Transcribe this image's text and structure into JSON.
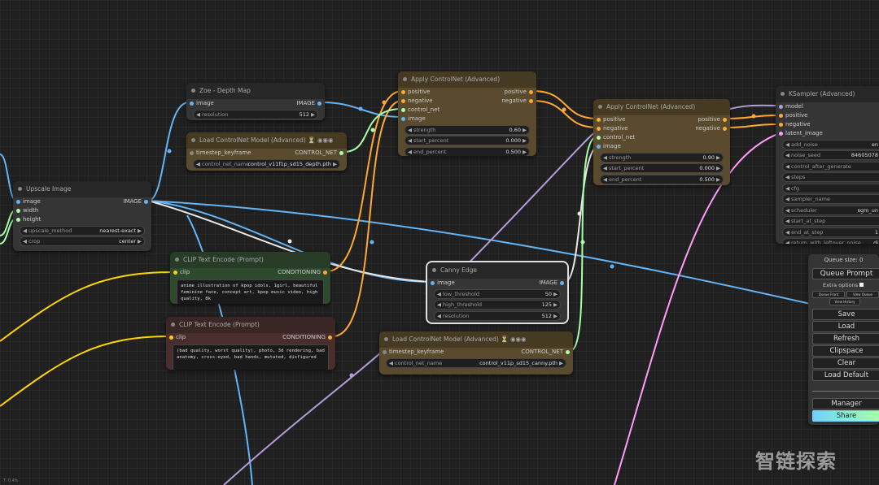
{
  "colors": {
    "image": "#64b5f6",
    "conditioning": "#ffa931",
    "control_net": "#a8ffa8",
    "model": "#b39ddb",
    "latent": "#ff9cf9",
    "int": "#a8ffa8",
    "clip": "#ffd500"
  },
  "nodes": {
    "zoe": {
      "title": "Zoe - Depth Map",
      "input": "image",
      "output": "IMAGE",
      "widgets": [
        {
          "name": "resolution",
          "value": "512"
        }
      ]
    },
    "load_cn_depth": {
      "title": "Load ControlNet Model (Advanced) ⏳ ◉◉◉",
      "input": "timestep_keyframe",
      "output": "CONTROL_NET",
      "widgets": [
        {
          "name": "control_net_name",
          "value": "control_v11f1p_sd15_depth.pth"
        }
      ]
    },
    "upscale": {
      "title": "Upscale Image",
      "inputs": [
        "image",
        "width",
        "height"
      ],
      "output": "IMAGE",
      "widgets": [
        {
          "name": "upscale_method",
          "value": "nearest-exact"
        },
        {
          "name": "crop",
          "value": "center"
        }
      ]
    },
    "apply1": {
      "title": "Apply ControlNet (Advanced)",
      "inputs": [
        "positive",
        "negative",
        "control_net",
        "image"
      ],
      "outputs": [
        "positive",
        "negative"
      ],
      "widgets": [
        {
          "name": "strength",
          "value": "0.60"
        },
        {
          "name": "start_percent",
          "value": "0.000"
        },
        {
          "name": "end_percent",
          "value": "0.500"
        }
      ]
    },
    "apply2": {
      "title": "Apply ControlNet (Advanced)",
      "inputs": [
        "positive",
        "negative",
        "control_net",
        "image"
      ],
      "outputs": [
        "positive",
        "negative"
      ],
      "widgets": [
        {
          "name": "strength",
          "value": "0.90"
        },
        {
          "name": "start_percent",
          "value": "0.000"
        },
        {
          "name": "end_percent",
          "value": "0.500"
        }
      ]
    },
    "ksampler": {
      "title": "KSampler (Advanced)",
      "inputs": [
        "model",
        "positive",
        "negative",
        "latent_image"
      ],
      "widgets": [
        {
          "name": "add_noise",
          "value": "en"
        },
        {
          "name": "noise_seed",
          "value": "84605078"
        },
        {
          "name": "control_after_generate",
          "value": ""
        },
        {
          "name": "steps",
          "value": ""
        },
        {
          "name": "cfg",
          "value": ""
        },
        {
          "name": "sampler_name",
          "value": ""
        },
        {
          "name": "scheduler",
          "value": "sgm_un"
        },
        {
          "name": "start_at_step",
          "value": ""
        },
        {
          "name": "end_at_step",
          "value": "1"
        },
        {
          "name": "return_with_leftover_noise",
          "value": "di"
        }
      ]
    },
    "clip_pos": {
      "title": "CLIP Text Encode (Prompt)",
      "input": "clip",
      "output": "CONDITIONING",
      "text": "anime illustration of kpop idols, 1girl, beautiful feminine face,  concept art, kpop music video, high quality, 8k"
    },
    "clip_neg": {
      "title": "CLIP Text Encode (Prompt)",
      "input": "clip",
      "output": "CONDITIONING",
      "text": "(bad quality, worst quality), photo, 3d rendering, bad anatomy, cross-eyed, bad hands, mutated, disfigured"
    },
    "canny": {
      "title": "Canny Edge",
      "input": "image",
      "output": "IMAGE",
      "widgets": [
        {
          "name": "low_threshold",
          "value": "50"
        },
        {
          "name": "high_threshold",
          "value": "125"
        },
        {
          "name": "resolution",
          "value": "512"
        }
      ]
    },
    "load_cn_canny": {
      "title": "Load ControlNet Model (Advanced) ⏳ ◉◉◉",
      "input": "timestep_keyframe",
      "output": "CONTROL_NET",
      "widgets": [
        {
          "name": "control_net_name",
          "value": "control_v11p_sd15_canny.pth"
        }
      ]
    }
  },
  "menu": {
    "queue_size": "Queue size: 0",
    "queue_prompt": "Queue Prompt",
    "extra_options": "Extra options",
    "queue_front": "Queue Front",
    "view_queue": "View Queue",
    "view_history": "View History",
    "save": "Save",
    "load": "Load",
    "refresh": "Refresh",
    "clipspace": "Clipspace",
    "clear": "Clear",
    "load_default": "Load Default",
    "manager": "Manager",
    "share": "Share"
  },
  "watermark": "智链探索",
  "zoom_label": "T: 0.4fs"
}
